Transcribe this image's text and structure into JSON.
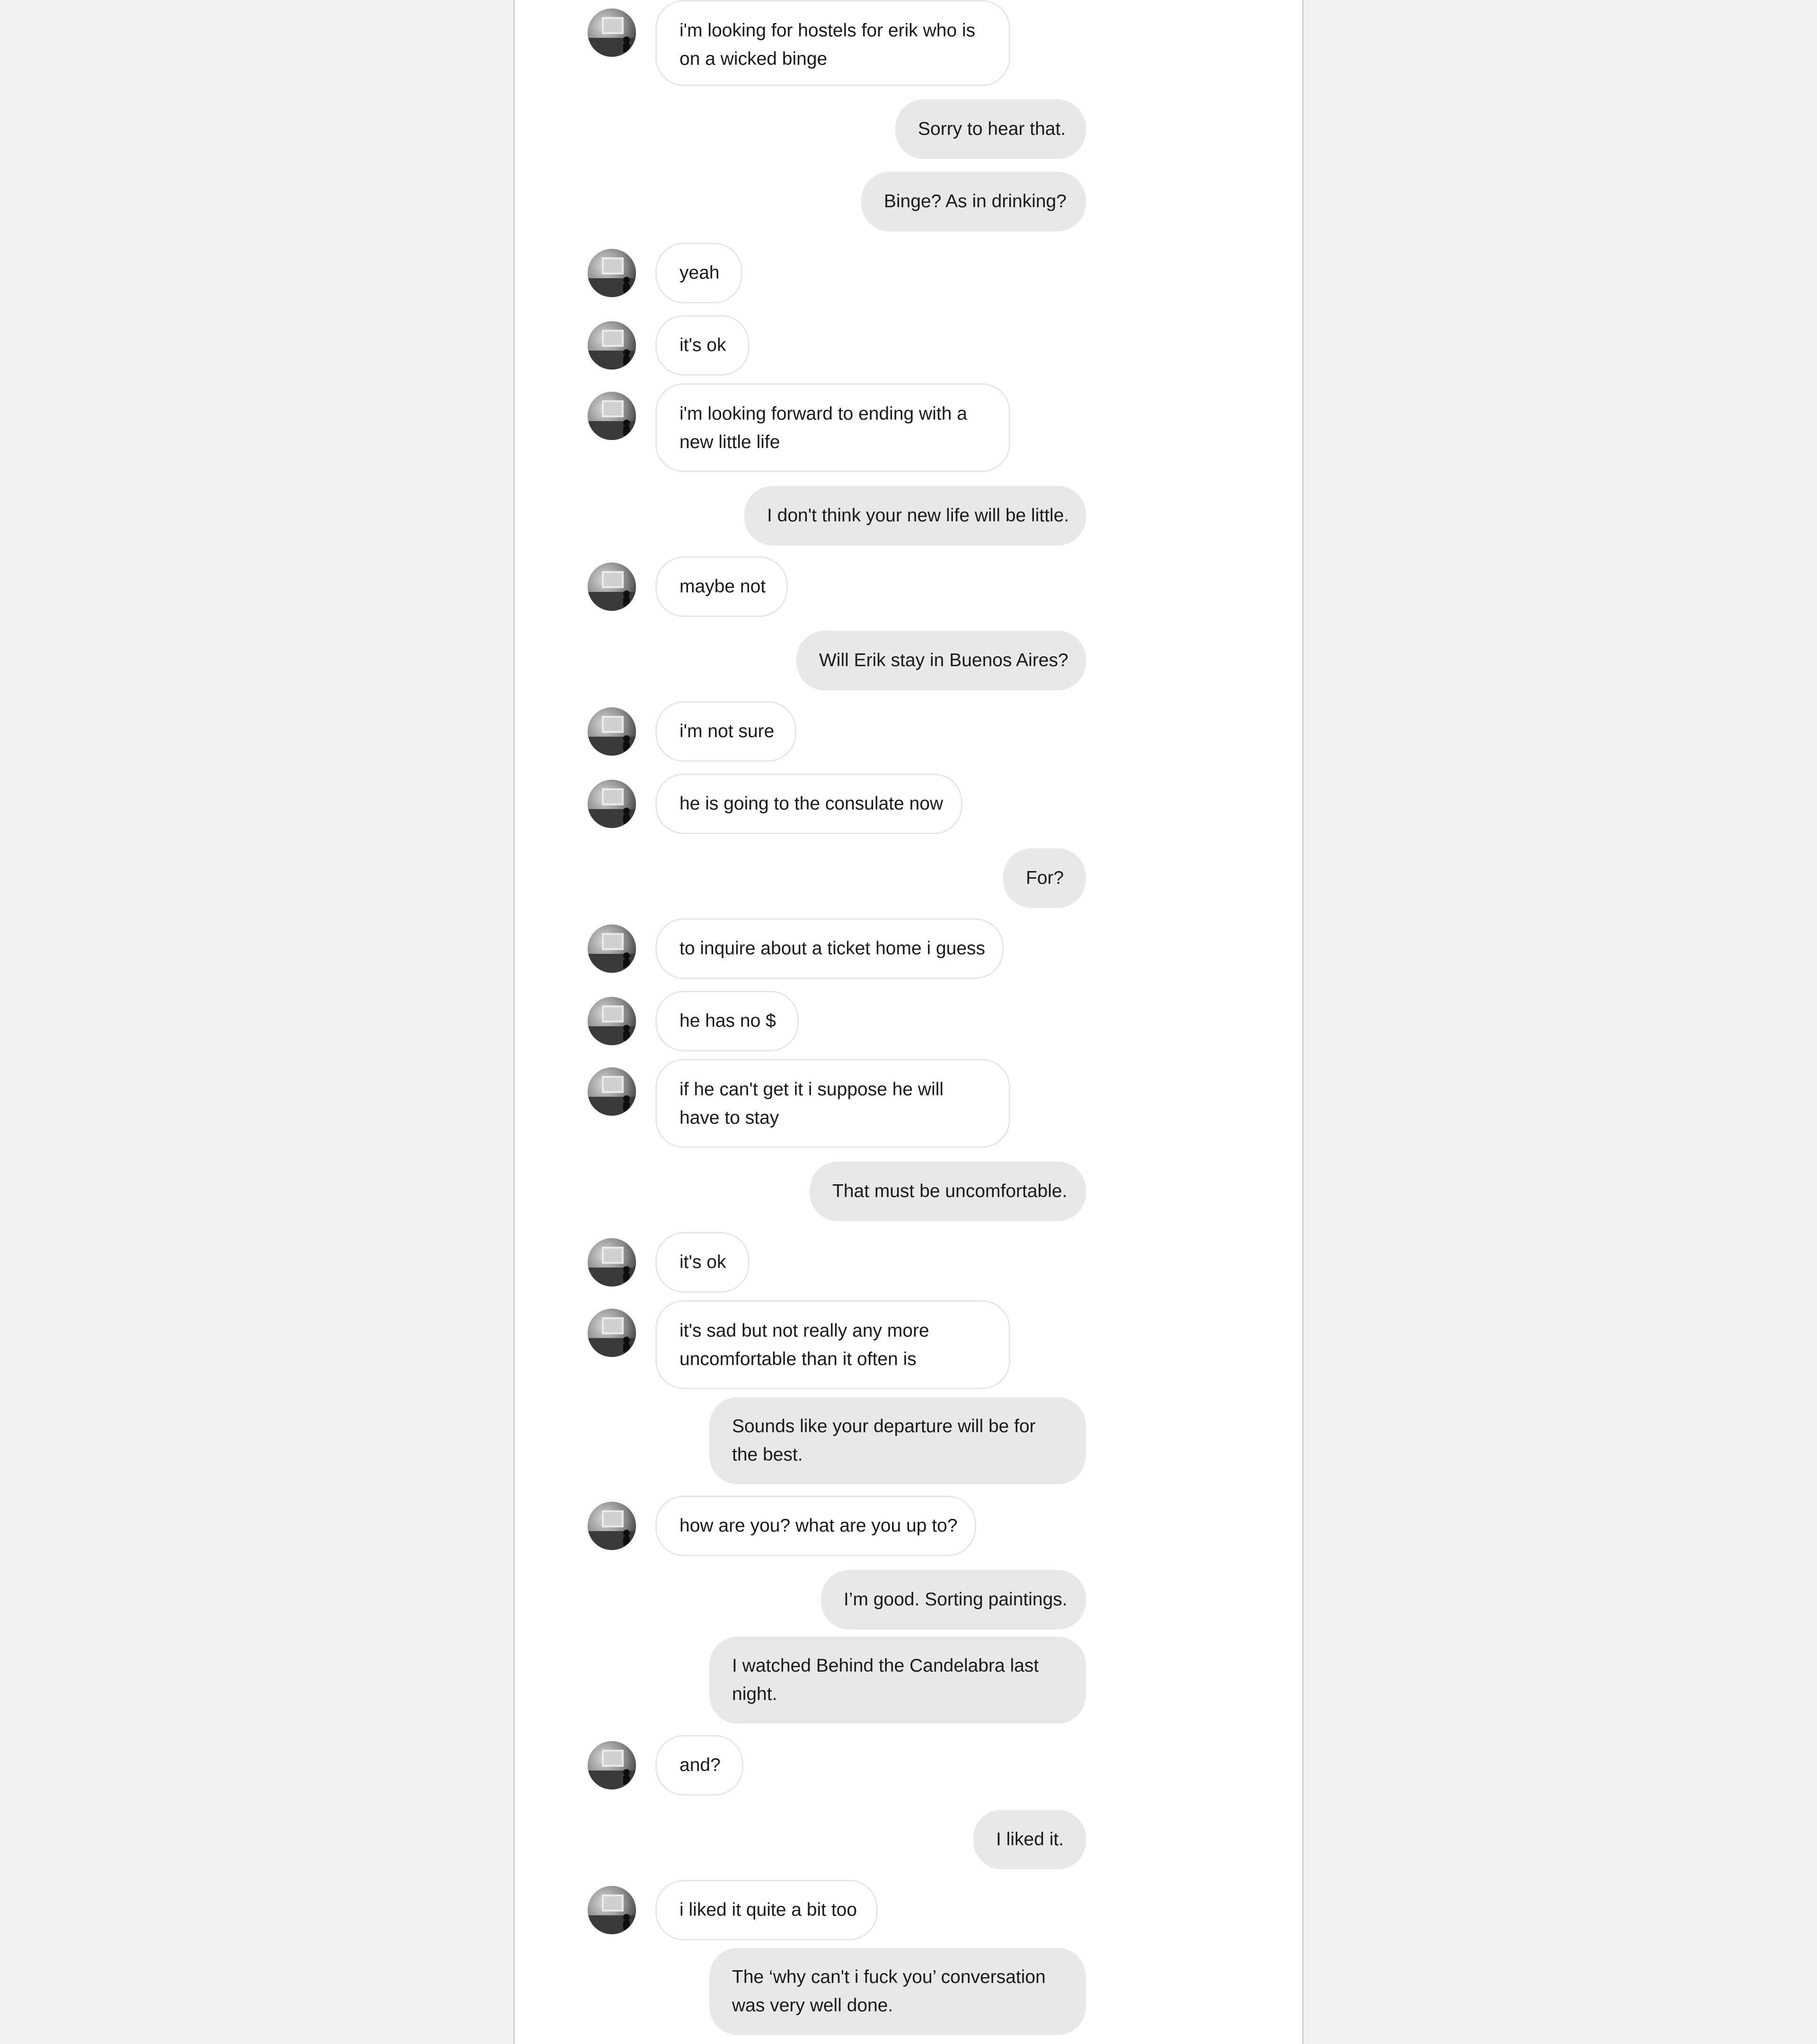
{
  "conversation": {
    "messages": [
      {
        "from": "them",
        "text": "i'm looking for hostels for erik who is on a wicked binge"
      },
      {
        "from": "me",
        "text": "Sorry to hear that."
      },
      {
        "from": "me",
        "text": "Binge? As in drinking?"
      },
      {
        "from": "them",
        "text": "yeah"
      },
      {
        "from": "them",
        "text": "it's ok"
      },
      {
        "from": "them",
        "text": "i'm looking forward to ending with a new little life"
      },
      {
        "from": "me",
        "text": "I don't think your new life will be little."
      },
      {
        "from": "them",
        "text": "maybe not"
      },
      {
        "from": "me",
        "text": "Will Erik stay in Buenos Aires?"
      },
      {
        "from": "them",
        "text": "i'm not sure"
      },
      {
        "from": "them",
        "text": "he is going to the consulate now"
      },
      {
        "from": "me",
        "text": "For?"
      },
      {
        "from": "them",
        "text": "to inquire about a ticket home i guess"
      },
      {
        "from": "them",
        "text": "he has no $"
      },
      {
        "from": "them",
        "text": "if he can't get it i suppose he will have to stay"
      },
      {
        "from": "me",
        "text": "That must be uncomfortable."
      },
      {
        "from": "them",
        "text": "it's ok"
      },
      {
        "from": "them",
        "text": "it's sad but not really any more uncomfortable than it often is"
      },
      {
        "from": "me",
        "text": "Sounds like your departure will be for the best."
      },
      {
        "from": "them",
        "text": "how are you? what are you up to?"
      },
      {
        "from": "me",
        "text": "I’m good. Sorting paintings."
      },
      {
        "from": "me",
        "text": "I watched Behind the Candelabra last night."
      },
      {
        "from": "them",
        "text": "and?"
      },
      {
        "from": "me",
        "text": "I liked it."
      },
      {
        "from": "them",
        "text": "i liked it quite a bit too"
      },
      {
        "from": "me",
        "text": "The ‘why can't i fuck you’ conversation was very well done."
      }
    ]
  }
}
